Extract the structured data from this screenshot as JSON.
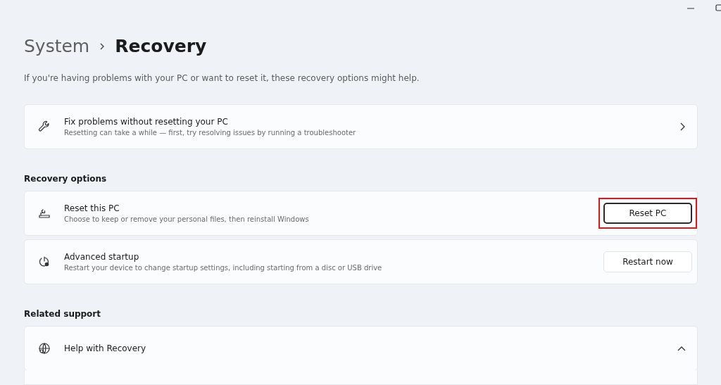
{
  "breadcrumb": [
    {
      "label": "System",
      "current": false
    },
    {
      "label": "Recovery",
      "current": true
    }
  ],
  "description": "If you're having problems with your PC or want to reset it, these recovery options might help.",
  "sections": [
    {
      "items": [
        {
          "kind": "link",
          "title": "Fix problems without resetting your PC",
          "subtitle": "Resetting can take a while — first, try resolving issues by running a troubleshooter"
        }
      ]
    },
    {
      "heading": "Recovery options",
      "items": [
        {
          "kind": "button",
          "title": "Reset this PC",
          "subtitle": "Choose to keep or remove your personal files, then reinstall Windows",
          "action": {
            "label": "Reset PC",
            "focused": true,
            "highlighted": true
          }
        },
        {
          "kind": "button",
          "title": "Advanced startup",
          "subtitle": "Restart your device to change startup settings, including starting from a disc or USB drive",
          "action": {
            "label": "Restart now",
            "focused": false,
            "highlighted": false
          }
        }
      ]
    },
    {
      "heading": "Related support",
      "items": [
        {
          "kind": "expander",
          "title": "Help with Recovery",
          "expanded": true
        }
      ]
    }
  ]
}
